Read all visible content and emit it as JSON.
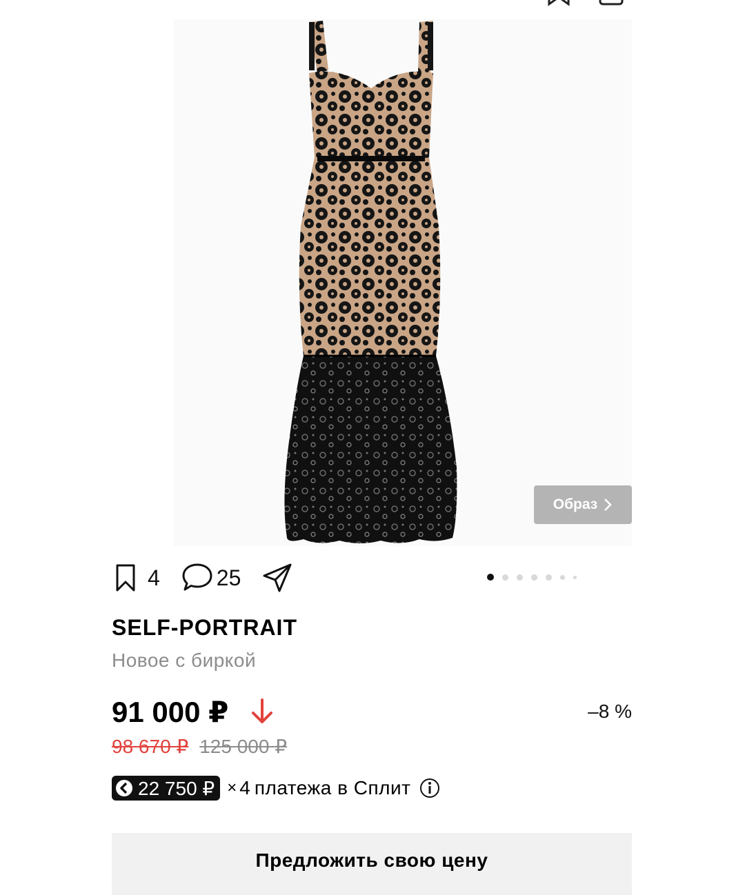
{
  "product": {
    "brand": "SELF-PORTRAIT",
    "condition": "Новое с биркой"
  },
  "gallery": {
    "look_button_label": "Образ",
    "image_count": 7,
    "current_image": 1
  },
  "actions": {
    "favorites_count": "4",
    "comments_count": "25"
  },
  "pricing": {
    "current_price": "91 000 ₽",
    "discount": "–8 %",
    "previous_price": "98 670 ₽",
    "original_price": "125 000 ₽"
  },
  "split": {
    "amount": "22 750 ₽",
    "times_sign": "×",
    "count": "4",
    "label": "платежа в Сплит"
  },
  "offer_button_label": "Предложить свою цену",
  "colors": {
    "accent_red": "#e2423c",
    "muted_gray": "#8c8c8c",
    "button_gray": "#b4b4b4",
    "offer_bg": "#f1f1f1"
  },
  "icons": [
    "bookmark-icon",
    "comment-icon",
    "share-icon",
    "chevron-right-icon",
    "arrow-down-icon",
    "split-logo-icon",
    "info-icon"
  ]
}
